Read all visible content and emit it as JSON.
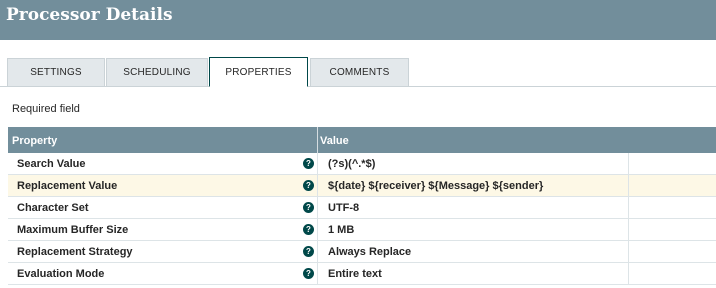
{
  "header": {
    "title": "Processor Details"
  },
  "tabs": [
    {
      "label": "SETTINGS"
    },
    {
      "label": "SCHEDULING"
    },
    {
      "label": "PROPERTIES"
    },
    {
      "label": "COMMENTS"
    }
  ],
  "required_label": "Required field",
  "grid": {
    "col_property": "Property",
    "col_value": "Value",
    "rows": [
      {
        "name": "Search Value",
        "help": "?",
        "value": "(?s)(^.*$)"
      },
      {
        "name": "Replacement Value",
        "help": "?",
        "value": "${date} ${receiver} ${Message} ${sender}"
      },
      {
        "name": "Character Set",
        "help": "?",
        "value": "UTF-8"
      },
      {
        "name": "Maximum Buffer Size",
        "help": "?",
        "value": "1 MB"
      },
      {
        "name": "Replacement Strategy",
        "help": "?",
        "value": "Always Replace"
      },
      {
        "name": "Evaluation Mode",
        "help": "?",
        "value": "Entire text"
      }
    ]
  },
  "colors": {
    "header_bg": "#728e9b",
    "accent": "#004849",
    "row_highlight": "#fdf8e6"
  }
}
